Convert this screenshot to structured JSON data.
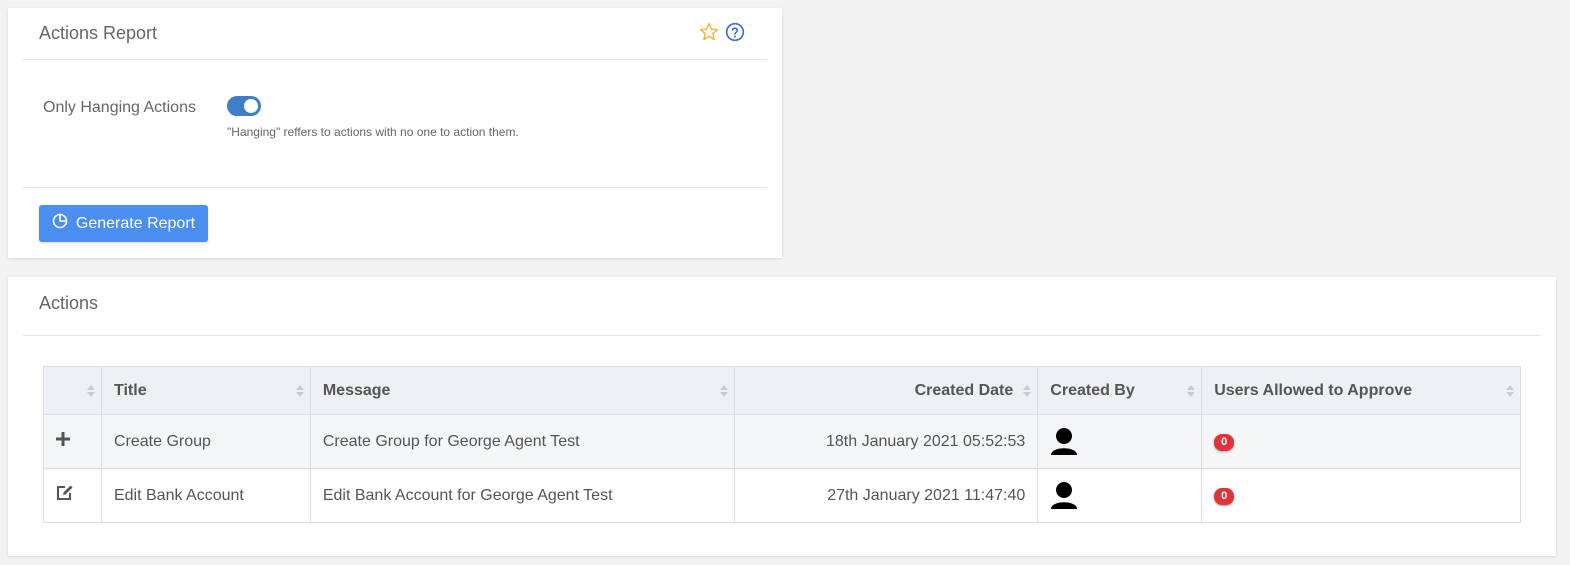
{
  "report_card": {
    "title": "Actions Report",
    "icons": [
      "star-icon",
      "help-circle-icon"
    ],
    "toggle_label": "Only Hanging Actions",
    "toggle_on": true,
    "toggle_help": "\"Hanging\" reffers to actions with no one to action them.",
    "generate_button_label": "Generate Report",
    "generate_button_icon": "pie-chart-icon"
  },
  "actions_card": {
    "title": "Actions",
    "columns": [
      "",
      "Title",
      "Message",
      "Created Date",
      "Created By",
      "Users Allowed to Approve"
    ],
    "rows": [
      {
        "icon": "plus-icon",
        "title": "Create Group",
        "message": "Create Group for George Agent Test",
        "created_date": "18th January 2021 05:52:53",
        "created_by_icon": "user-icon",
        "users_allowed": "0"
      },
      {
        "icon": "edit-icon",
        "title": "Edit Bank Account",
        "message": "Edit Bank Account for George Agent Test",
        "created_date": "27th January 2021 11:47:40",
        "created_by_icon": "user-icon",
        "users_allowed": "0"
      }
    ]
  },
  "colors": {
    "background": "#f2f2f2",
    "primary_button": "#4a8ef0",
    "toggle_on": "#3f7ec9",
    "star": "#f0b840",
    "help": "#3d6fd6",
    "badge": "#e0343c",
    "table_header": "#eef0f4"
  }
}
